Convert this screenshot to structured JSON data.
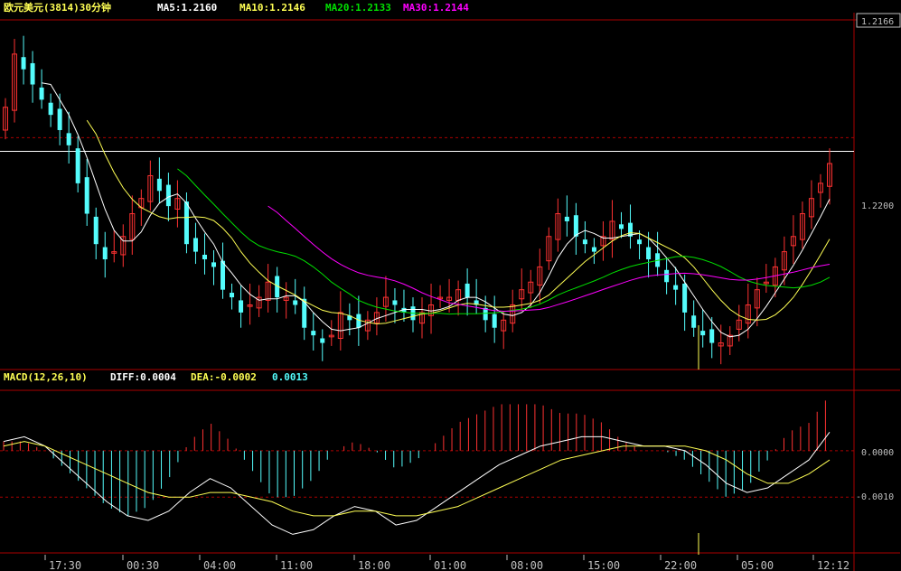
{
  "header": {
    "symbol": "欧元美元(3814)30分钟",
    "ma5": "MA5:1.2160",
    "ma10": "MA10:1.2146",
    "ma20": "MA20:1.2133",
    "ma30": "MA30:1.2144"
  },
  "macd_header": {
    "name": "MACD(12,26,10)",
    "diff": "DIFF:0.0004",
    "dea": "DEA:-0.0002",
    "macd": "0.0013"
  },
  "price_axis": {
    "last_price": "1.2166",
    "level_label": "1.2200"
  },
  "macd_axis": {
    "zero_label": "0.0000",
    "neg_label": "-0.0010"
  },
  "time_axis": [
    "17:30",
    "00:30",
    "04:00",
    "11:00",
    "18:00",
    "01:00",
    "08:00",
    "15:00",
    "22:00",
    "05:00",
    "12:12"
  ],
  "colors": {
    "up": "#ff3232",
    "down": "#54fcfc",
    "ma5": "#ffffff",
    "ma10": "#ffff54",
    "ma20": "#00e000",
    "ma30": "#ff00ff",
    "grid": "#aa0000"
  },
  "chart_data": {
    "type": "candlestick",
    "interval": "30分钟",
    "price_range": [
      1.1895,
      1.2355
    ],
    "price_levels": [
      1.22
    ],
    "horizontal_line": 1.2182,
    "candles_close": [
      1.224,
      1.231,
      1.229,
      1.227,
      1.225,
      1.223,
      1.221,
      1.219,
      1.214,
      1.21,
      1.206,
      1.204,
      1.205,
      1.207,
      1.21,
      1.212,
      1.215,
      1.213,
      1.211,
      1.212,
      1.206,
      1.205,
      1.204,
      1.203,
      1.2,
      1.199,
      1.197,
      1.198,
      1.199,
      1.201,
      1.199,
      1.199,
      1.198,
      1.195,
      1.194,
      1.193,
      1.194,
      1.197,
      1.196,
      1.195,
      1.196,
      1.197,
      1.199,
      1.198,
      1.197,
      1.196,
      1.197,
      1.198,
      1.199,
      1.199,
      1.2,
      1.199,
      1.198,
      1.196,
      1.195,
      1.196,
      1.198,
      1.2,
      1.201,
      1.203,
      1.207,
      1.21,
      1.209,
      1.207,
      1.206,
      1.205,
      1.207,
      1.209,
      1.208,
      1.207,
      1.206,
      1.204,
      1.203,
      1.201,
      1.2,
      1.197,
      1.195,
      1.194,
      1.193,
      1.193,
      1.194,
      1.196,
      1.198,
      1.2,
      1.201,
      1.203,
      1.205,
      1.207,
      1.21,
      1.212,
      1.214,
      1.2166
    ],
    "macd": {
      "zero_line": 0.0,
      "level": -0.001,
      "diff": [
        0.0002,
        0.0003,
        0.0001,
        -0.0003,
        -0.0007,
        -0.0011,
        -0.0014,
        -0.0015,
        -0.0013,
        -0.0009,
        -0.0006,
        -0.0008,
        -0.0012,
        -0.0016,
        -0.0018,
        -0.0017,
        -0.0014,
        -0.0012,
        -0.0013,
        -0.0016,
        -0.0015,
        -0.0012,
        -0.0009,
        -0.0006,
        -0.0003,
        -0.0001,
        0.0001,
        0.0002,
        0.0003,
        0.0003,
        0.0002,
        0.0001,
        0.0001,
        0.0,
        -0.0003,
        -0.0007,
        -0.0009,
        -0.0008,
        -0.0005,
        -0.0002,
        0.0004
      ],
      "dea": [
        0.0001,
        0.0002,
        0.0001,
        -0.0001,
        -0.0003,
        -0.0005,
        -0.0007,
        -0.0009,
        -0.001,
        -0.001,
        -0.0009,
        -0.0009,
        -0.001,
        -0.0011,
        -0.0013,
        -0.0014,
        -0.0014,
        -0.0013,
        -0.0013,
        -0.0014,
        -0.0014,
        -0.0013,
        -0.0012,
        -0.001,
        -0.0008,
        -0.0006,
        -0.0004,
        -0.0002,
        -0.0001,
        0.0,
        0.0001,
        0.0001,
        0.0001,
        0.0001,
        0.0,
        -0.0002,
        -0.0005,
        -0.0007,
        -0.0007,
        -0.0005,
        -0.0002
      ],
      "range": [
        -0.0022,
        0.0013
      ]
    }
  }
}
